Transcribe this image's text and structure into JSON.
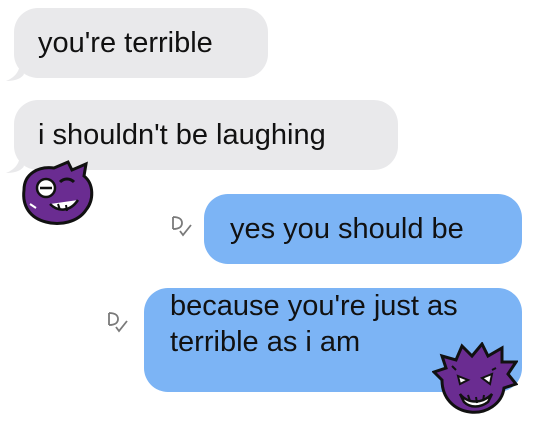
{
  "conversation": {
    "messages": [
      {
        "direction": "received",
        "text": "you're terrible"
      },
      {
        "direction": "received",
        "text": "i shouldn't be laughing"
      },
      {
        "direction": "sent",
        "text": "yes you should be"
      },
      {
        "direction": "sent",
        "text": "because you're just as terrible as i am"
      }
    ],
    "stickers": [
      {
        "name": "purple-creature-sticker",
        "color": "#6a2c91"
      },
      {
        "name": "purple-creature-sticker",
        "color": "#6a2c91"
      }
    ],
    "status_icon": "read-receipt-icon",
    "colors": {
      "received_bubble": "#e9e9eb",
      "sent_bubble": "#7cb4f5",
      "text": "#111111"
    }
  }
}
